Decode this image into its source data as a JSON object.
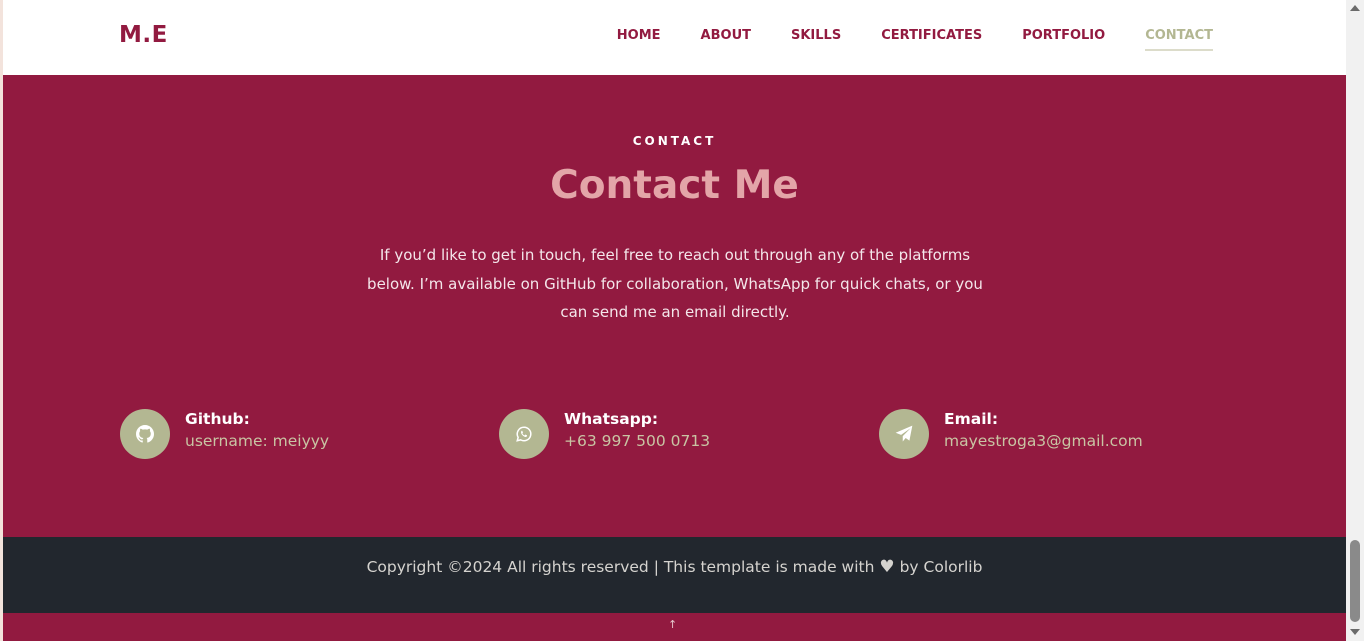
{
  "header": {
    "logo": "M.E",
    "nav": [
      {
        "label": "HOME"
      },
      {
        "label": "ABOUT"
      },
      {
        "label": "SKILLS"
      },
      {
        "label": "CERTIFICATES"
      },
      {
        "label": "PORTFOLIO"
      },
      {
        "label": "CONTACT",
        "active": true
      }
    ]
  },
  "contact": {
    "eyebrow": "CONTACT",
    "title": "Contact Me",
    "description": "If you’d like to get in touch, feel free to reach out through any of the platforms below. I’m available on GitHub for collaboration, WhatsApp for quick chats, or you can send me an email directly.",
    "items": [
      {
        "icon": "github-icon",
        "label": "Github:",
        "value": "username: meiyyy"
      },
      {
        "icon": "whatsapp-icon",
        "label": "Whatsapp:",
        "value": "+63 997 500 0713"
      },
      {
        "icon": "send-icon",
        "label": "Email:",
        "value": "mayestroga3@gmail.com"
      }
    ]
  },
  "footer": {
    "copyright_prefix": "Copyright ©2024 All rights reserved | This template is made with",
    "heart_icon": "heart-icon",
    "copyright_by": "by",
    "credit": "Colorlib",
    "back_to_top": "↑"
  },
  "colors": {
    "brand": "#921a40",
    "accent": "#b3b792",
    "title": "#e3a5a8",
    "footer": "#22272e",
    "header": "#ffffff"
  }
}
